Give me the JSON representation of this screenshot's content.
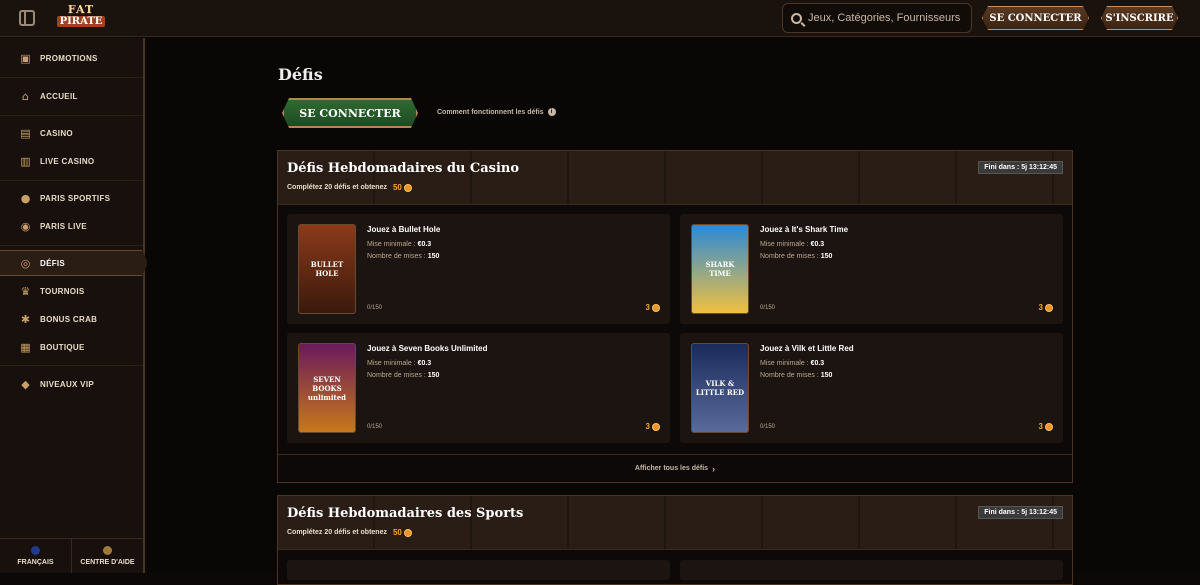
{
  "header": {
    "logo_top": "FAT",
    "logo_bottom": "PIRATE",
    "search_placeholder": "Jeux, Catégories, Fournisseurs",
    "login_label": "SE CONNECTER",
    "register_label": "S'INSCRIRE"
  },
  "sidebar": {
    "items": [
      {
        "label": "PROMOTIONS",
        "icon": "gift-icon"
      },
      {
        "label": "ACCUEIL",
        "icon": "home-icon"
      },
      {
        "label": "CASINO",
        "icon": "cards-icon"
      },
      {
        "label": "LIVE CASINO",
        "icon": "live-cards-icon"
      },
      {
        "label": "PARIS SPORTIFS",
        "icon": "ball-icon"
      },
      {
        "label": "PARIS LIVE",
        "icon": "live-ball-icon"
      },
      {
        "label": "DÉFIS",
        "icon": "target-icon"
      },
      {
        "label": "TOURNOIS",
        "icon": "trophy-icon"
      },
      {
        "label": "BONUS CRAB",
        "icon": "crab-icon"
      },
      {
        "label": "BOUTIQUE",
        "icon": "shop-icon"
      },
      {
        "label": "NIVEAUX VIP",
        "icon": "diamond-icon"
      }
    ],
    "footer": {
      "language": "FRANÇAIS",
      "help": "CENTRE D'AIDE"
    }
  },
  "main": {
    "title": "Défis",
    "login_button": "SE CONNECTER",
    "how_link": "Comment fonctionnent les défis"
  },
  "casino_panel": {
    "title": "Défis Hebdomadaires du Casino",
    "subtitle": "Complétez 20 défis et obtenez",
    "reward": "50",
    "timer": "Fini dans : 5j 13:12:45",
    "show_all": "Afficher tous les défis",
    "cards": [
      {
        "title": "Jouez à Bullet Hole",
        "min_label": "Mise minimale :",
        "min_value": "€0.3",
        "bets_label": "Nombre de mises :",
        "bets_value": "150",
        "progress": "0/150",
        "reward": "3",
        "thumb_text": "BULLET HOLE"
      },
      {
        "title": "Jouez à It's Shark Time",
        "min_label": "Mise minimale :",
        "min_value": "€0.3",
        "bets_label": "Nombre de mises :",
        "bets_value": "150",
        "progress": "0/150",
        "reward": "3",
        "thumb_text": "SHARK TIME"
      },
      {
        "title": "Jouez à Seven Books Unlimited",
        "min_label": "Mise minimale :",
        "min_value": "€0.3",
        "bets_label": "Nombre de mises :",
        "bets_value": "150",
        "progress": "0/150",
        "reward": "3",
        "thumb_text": "SEVEN BOOKS unlimited"
      },
      {
        "title": "Jouez à Vilk et Little Red",
        "min_label": "Mise minimale :",
        "min_value": "€0.3",
        "bets_label": "Nombre de mises :",
        "bets_value": "150",
        "progress": "0/150",
        "reward": "3",
        "thumb_text": "VILK & LITTLE RED"
      }
    ]
  },
  "sports_panel": {
    "title": "Défis Hebdomadaires des Sports",
    "subtitle": "Complétez 20 défis et obtenez",
    "reward": "50",
    "timer": "Fini dans : 5j 13:12:45"
  }
}
